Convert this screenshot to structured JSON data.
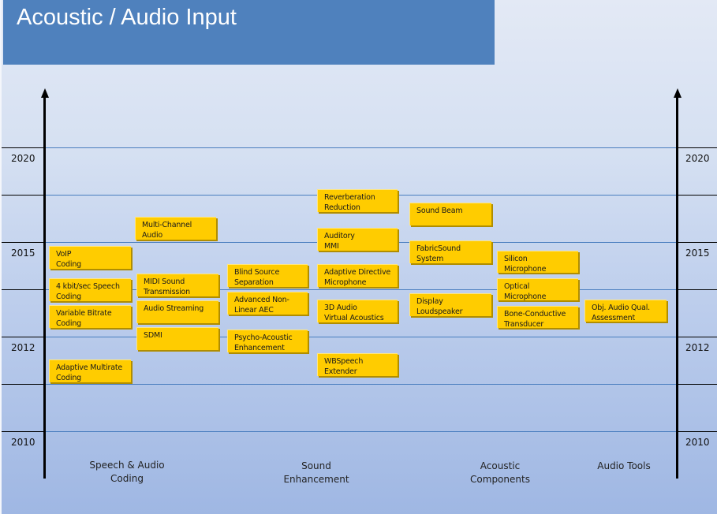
{
  "title": "Acoustic / Audio Input",
  "years": {
    "y2020": "2020",
    "y2015": "2015",
    "y2012": "2012",
    "y2010": "2010"
  },
  "categories": [
    {
      "id": "speech-audio-coding",
      "label": "Speech & Audio\nCoding"
    },
    {
      "id": "sound-enhancement",
      "label": "Sound\nEnhancement"
    },
    {
      "id": "acoustic-components",
      "label": "Acoustic\nComponents"
    },
    {
      "id": "audio-tools",
      "label": "Audio Tools"
    }
  ],
  "technologies": {
    "voip_coding": "VoIP\nCoding",
    "speech_4kbit": "4 kbit/sec Speech\nCoding",
    "variable_bitrate": "Variable Bitrate\nCoding",
    "adaptive_multirate": "Adaptive Multirate\nCoding",
    "multi_channel": "Multi-Channel\nAudio",
    "midi_sound": "MIDI Sound\nTransmission",
    "audio_streaming": "Audio Streaming",
    "sdmi": "SDMI",
    "blind_source": "Blind Source\nSeparation",
    "advanced_nonlinear": "Advanced Non-\nLinear AEC",
    "psycho_acoustic": "Psycho-Acoustic\nEnhancement",
    "reverberation": "Reverberation\nReduction",
    "auditory_mmi": "Auditory\nMMI",
    "adaptive_directive": "Adaptive Directive\nMicrophone",
    "audio_3d": "3D Audio\nVirtual Acoustics",
    "wbspeech": "WBSpeech\nExtender",
    "sound_beam": "Sound Beam",
    "fabric_sound": "FabricSound\nSystem",
    "display_loudspeaker": "Display\nLoudspeaker",
    "silicon_mic": "Silicon\nMicrophone",
    "optical_mic": "Optical\nMicrophone",
    "bone_conductive": "Bone-Conductive\nTransducer",
    "obj_audio_qual": "Obj. Audio Qual.\nAssessment"
  }
}
